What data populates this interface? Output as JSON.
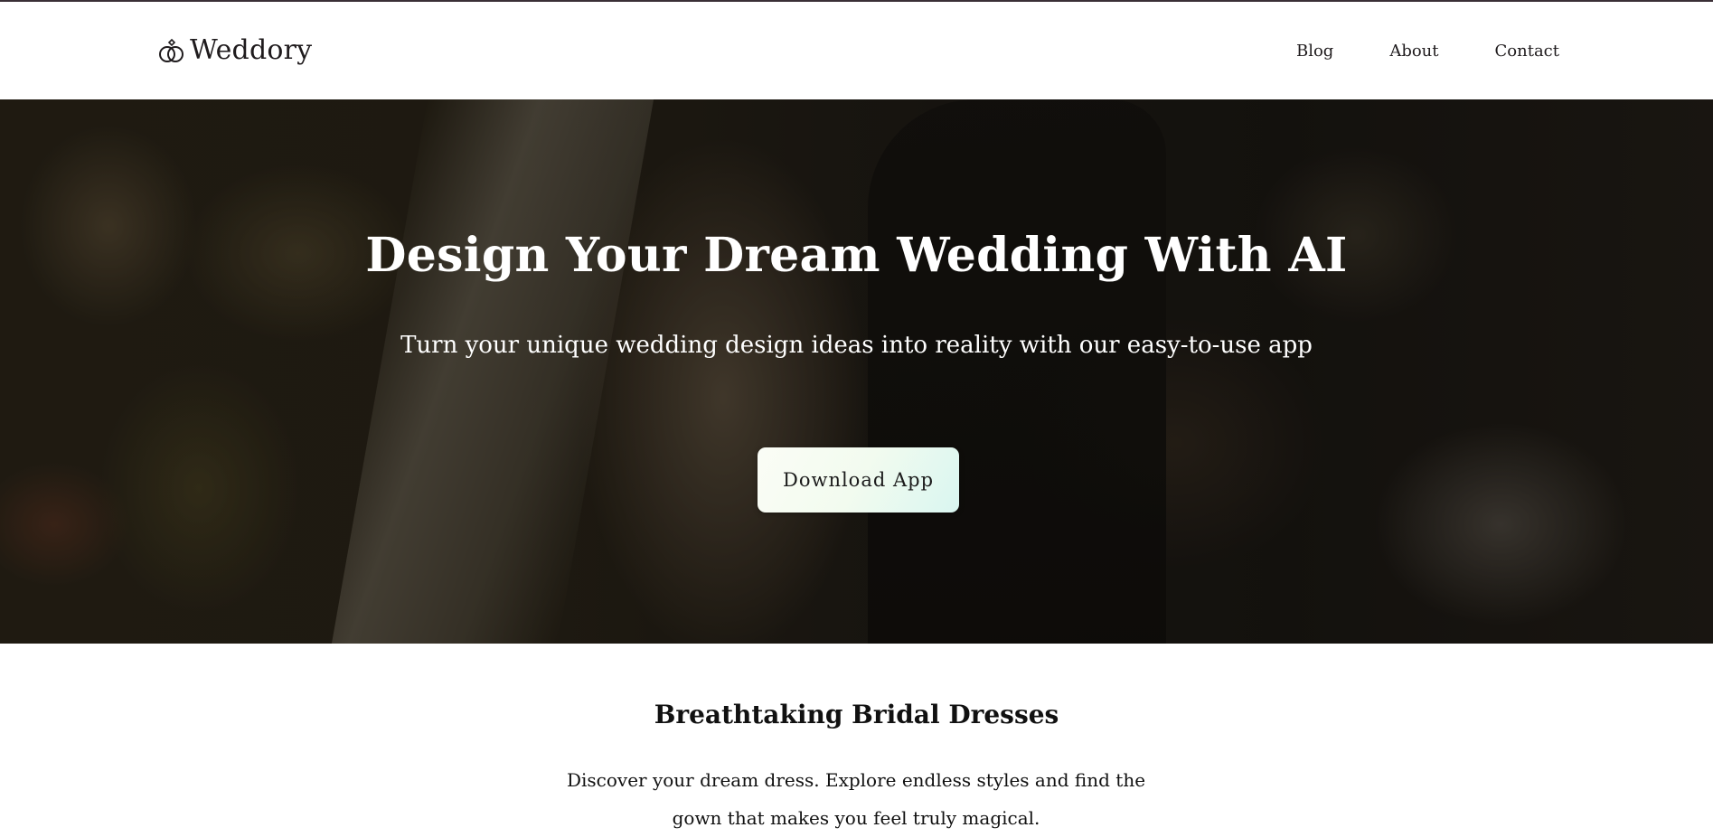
{
  "brand": {
    "name": "Weddory",
    "icon": "rings-icon"
  },
  "nav": {
    "items": [
      {
        "label": "Blog"
      },
      {
        "label": "About"
      },
      {
        "label": "Contact"
      }
    ]
  },
  "hero": {
    "title": "Design Your Dream Wedding With AI",
    "subtitle": "Turn your unique wedding design ideas into reality with our easy-to-use  app",
    "cta_label": "Download App",
    "background": "wedding-couple-photo"
  },
  "feature": {
    "title": "Breathtaking Bridal Dresses",
    "text": "Discover your dream dress. Explore endless styles and find the gown that makes you feel truly magical."
  },
  "colors": {
    "text_dark": "#1f1b1d",
    "hero_text": "#ffffff",
    "button_gradient": [
      "#fbfdf6",
      "#d9f6f0"
    ]
  }
}
